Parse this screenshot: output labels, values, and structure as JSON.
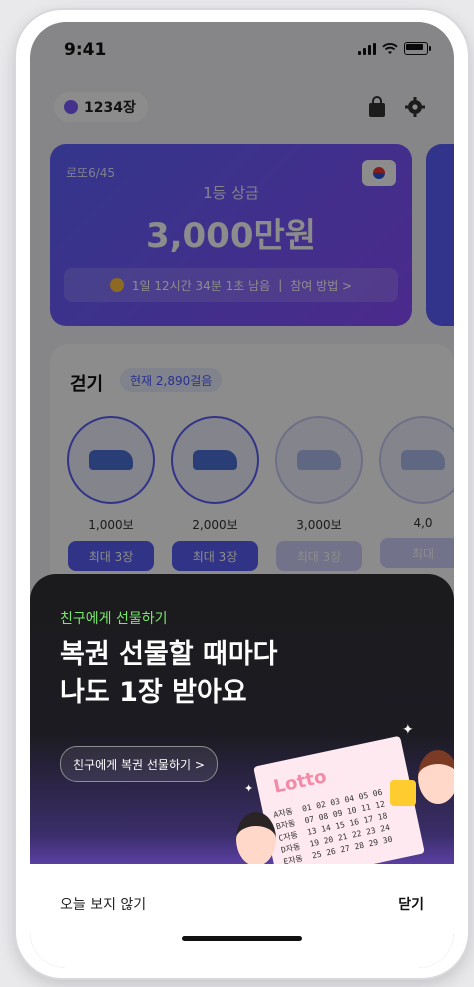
{
  "status": {
    "time": "9:41"
  },
  "header": {
    "ticket_count": "1234장"
  },
  "lotto": {
    "label": "로또6/45",
    "prize_label": "1등 상금",
    "prize_amount": "3,000만원",
    "countdown": "1일 12시간 34분 1초 남음",
    "how_to": "참여 방법 >"
  },
  "walk": {
    "title": "걷기",
    "current": "현재 2,890걸음",
    "items": [
      {
        "steps": "1,000보",
        "reward": "최대 3장"
      },
      {
        "steps": "2,000보",
        "reward": "최대 3장"
      },
      {
        "steps": "3,000보",
        "reward": "최대 3장"
      },
      {
        "steps": "4,0",
        "reward": "최대"
      }
    ]
  },
  "promo": {
    "kicker": "친구에게 선물하기",
    "title_line1": "복권 선물할 때마다",
    "title_line2": "나도 1장 받아요",
    "button_label": "친구에게 복권 선물하기 >",
    "ticket_logo": "Lotto",
    "ticket_rows": "A자동  01 02 03 04 05 06\nB자동  07 08 09 10 11 12\nC자동  13 14 15 16 17 18\nD자동  19 20 21 22 23 24\nE자동  25 26 27 28 29 30"
  },
  "footer": {
    "dont_show_today": "오늘 보지 않기",
    "close": "닫기"
  }
}
